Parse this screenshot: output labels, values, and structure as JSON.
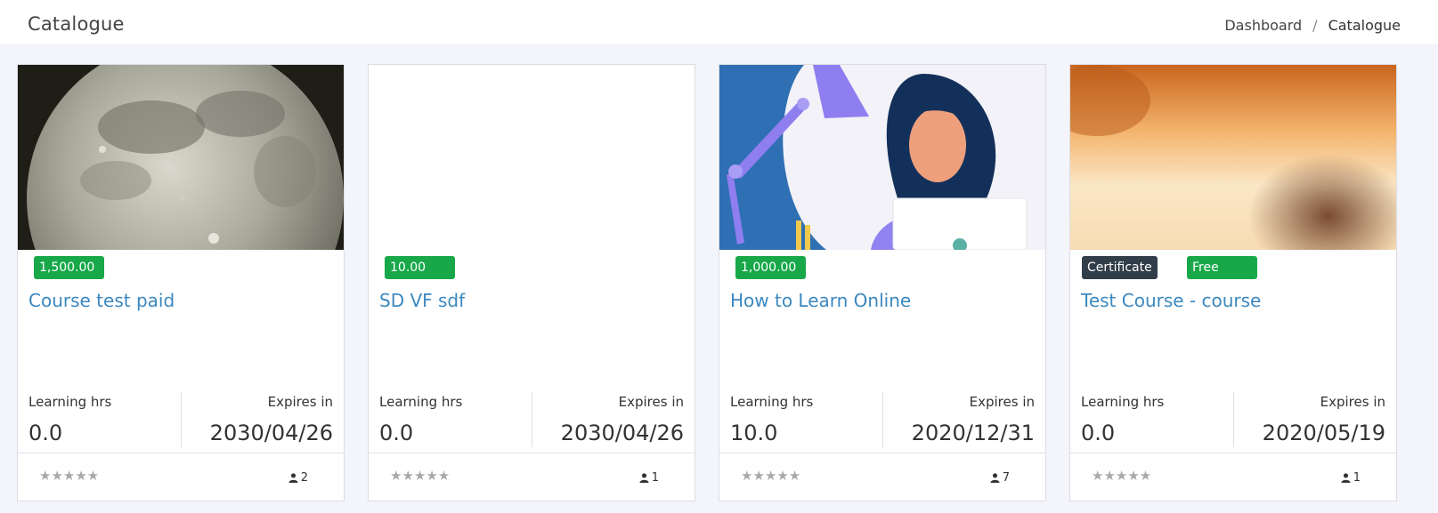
{
  "header": {
    "title": "Catalogue",
    "breadcrumb": [
      {
        "label": "Dashboard"
      },
      {
        "label": "Catalogue"
      }
    ]
  },
  "colors": {
    "accent_title": "#3b88bf",
    "price_badge": "#18a84a",
    "certificate_badge": "#323d4a",
    "star": "#a9a9a9"
  },
  "labels": {
    "learning_hrs": "Learning hrs",
    "expires_in": "Expires in"
  },
  "cards": [
    {
      "thumbnail": "moon-image",
      "price": "1,500.00",
      "title": "Course test paid",
      "learning_hrs": "0.0",
      "expires": "2030/04/26",
      "rating": "★★★★★",
      "enrolled": "2"
    },
    {
      "thumbnail": "blank-image",
      "price": "10.00",
      "title": "SD VF sdf",
      "learning_hrs": "0.0",
      "expires": "2030/04/26",
      "rating": "★★★★★",
      "enrolled": "1"
    },
    {
      "thumbnail": "woman-laptop-illustration",
      "price": "1,000.00",
      "title": "How to Learn Online",
      "learning_hrs": "10.0",
      "expires": "2020/12/31",
      "rating": "★★★★★",
      "enrolled": "7"
    },
    {
      "thumbnail": "blurred-orange-image",
      "certificate": "Certificate",
      "price": "Free",
      "title": "Test Course - course",
      "learning_hrs": "0.0",
      "expires": "2020/05/19",
      "rating": "★★★★★",
      "enrolled": "1"
    }
  ]
}
